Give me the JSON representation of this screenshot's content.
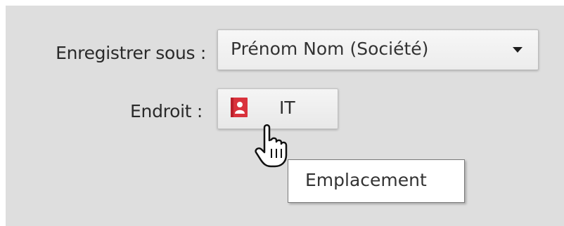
{
  "form": {
    "save_as_label": "Enregistrer sous :",
    "save_as_value": "Prénom Nom (Société)",
    "location_label": "Endroit :",
    "location_value": "IT"
  },
  "tooltip": {
    "text": "Emplacement"
  },
  "icons": {
    "dropdown": "chevron-down-icon",
    "contacts": "contacts-book-icon",
    "cursor": "hand-pointer-cursor-icon"
  },
  "colors": {
    "panel_background": "#dedede",
    "contacts_icon_red": "#d9323c"
  }
}
